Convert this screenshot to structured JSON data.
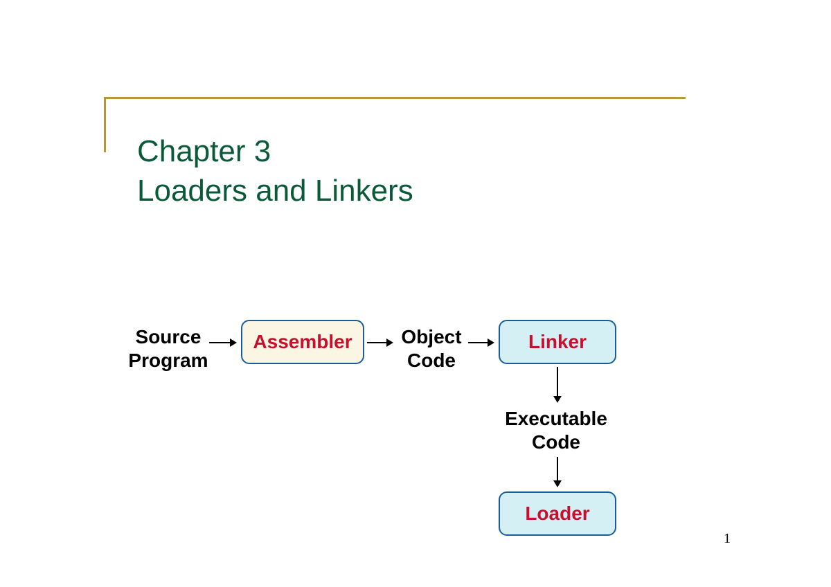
{
  "title": {
    "line1": "Chapter 3",
    "line2": "Loaders and Linkers"
  },
  "diagram": {
    "source_program": "Source\nProgram",
    "assembler": "Assembler",
    "object_code": "Object\nCode",
    "linker": "Linker",
    "executable_code": "Executable\nCode",
    "loader": "Loader"
  },
  "page_number": "1",
  "colors": {
    "accent": "#b8973a",
    "title": "#0a5a3a",
    "box_border": "#1a5c99",
    "box_yellow_bg": "#fbf6e3",
    "box_blue_bg": "#d5f0f5",
    "box_text": "#c8102e"
  }
}
